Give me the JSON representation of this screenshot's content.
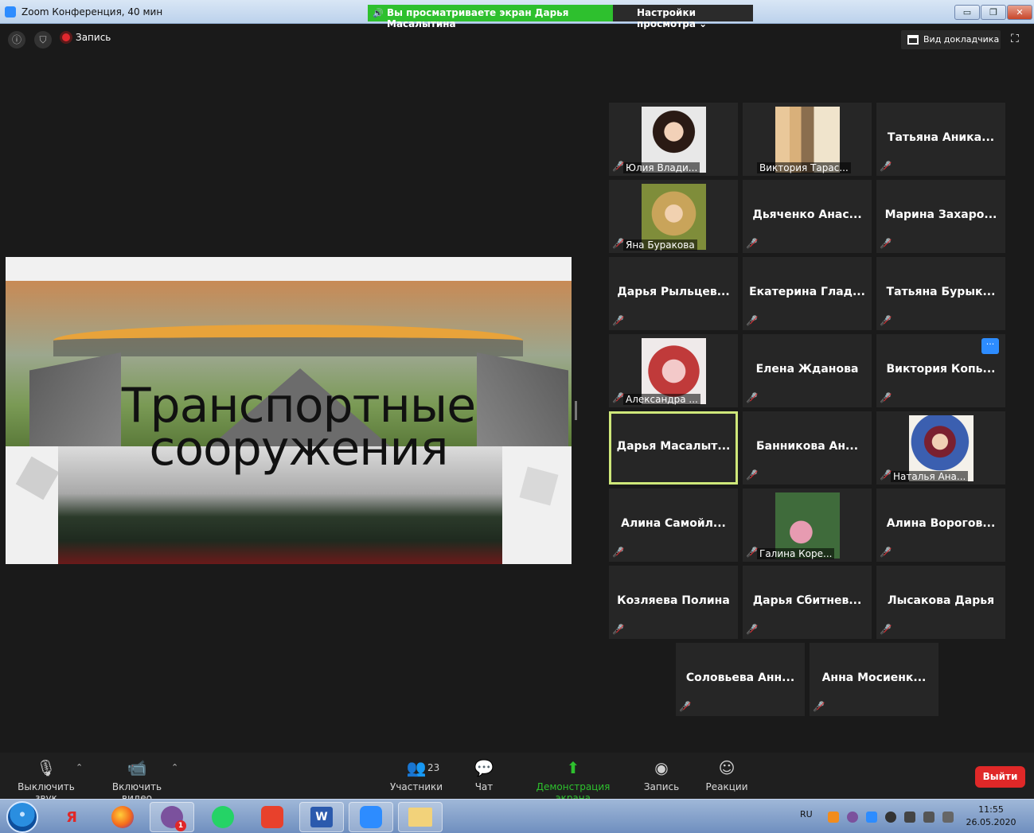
{
  "window": {
    "title": "Zoom Конференция, 40 мин",
    "viewing_banner": "Вы просматриваете экран Дарья Масалытина",
    "view_settings": "Настройки просмотра ⌄",
    "min_label": "▭",
    "max_label": "❐",
    "close_label": "✕"
  },
  "top": {
    "record_label": "Запись",
    "speaker_view_label": "Вид докладчика"
  },
  "slide": {
    "title_line1": "Транспортные",
    "title_line2": "сооружения"
  },
  "gallery": [
    {
      "name": "Юлия Влади...",
      "photo": true
    },
    {
      "name": "Виктория Тарас...",
      "photo": true
    },
    {
      "name": "Татьяна Аника...",
      "photo": false
    },
    {
      "name": "Яна Буракова",
      "photo": true
    },
    {
      "name": "Дьяченко Анас...",
      "photo": false
    },
    {
      "name": "Марина Захаро...",
      "photo": false
    },
    {
      "name": "Дарья Рыльцев...",
      "photo": false
    },
    {
      "name": "Екатерина Глад...",
      "photo": false
    },
    {
      "name": "Татьяна Бурык...",
      "photo": false
    },
    {
      "name": "Александра ...",
      "photo": true
    },
    {
      "name": "Елена Жданова",
      "photo": false
    },
    {
      "name": "Виктория Копь...",
      "photo": false
    },
    {
      "name": "Дарья Масалыт...",
      "photo": false
    },
    {
      "name": "Банникова Ан...",
      "photo": false
    },
    {
      "name": "Наталья Ана...",
      "photo": true
    },
    {
      "name": "Алина Самойл...",
      "photo": false
    },
    {
      "name": "Галина Коре...",
      "photo": true
    },
    {
      "name": "Алина Ворогов...",
      "photo": false
    },
    {
      "name": "Козляева Полина",
      "photo": false
    },
    {
      "name": "Дарья Сбитнев...",
      "photo": false
    },
    {
      "name": "Лысакова Дарья",
      "photo": false
    },
    {
      "name": "Соловьева Анн...",
      "photo": false
    },
    {
      "name": "Анна Мосиенк...",
      "photo": false
    }
  ],
  "toolbar": {
    "mute_label": "Выключить звук",
    "video_label": "Включить видео",
    "participants_label": "Участники",
    "participants_count": "23",
    "chat_label": "Чат",
    "share_label": "Демонстрация экрана",
    "record_label": "Запись",
    "reactions_label": "Реакции",
    "leave_label": "Выйти"
  },
  "taskbar": {
    "lang": "RU",
    "time": "11:55",
    "date": "26.05.2020",
    "viber_badge": "1"
  },
  "colors": {
    "accent_green": "#2ec02e",
    "leave_red": "#e02828",
    "active_border": "#cfe87a",
    "zoom_blue": "#2d8cff"
  }
}
